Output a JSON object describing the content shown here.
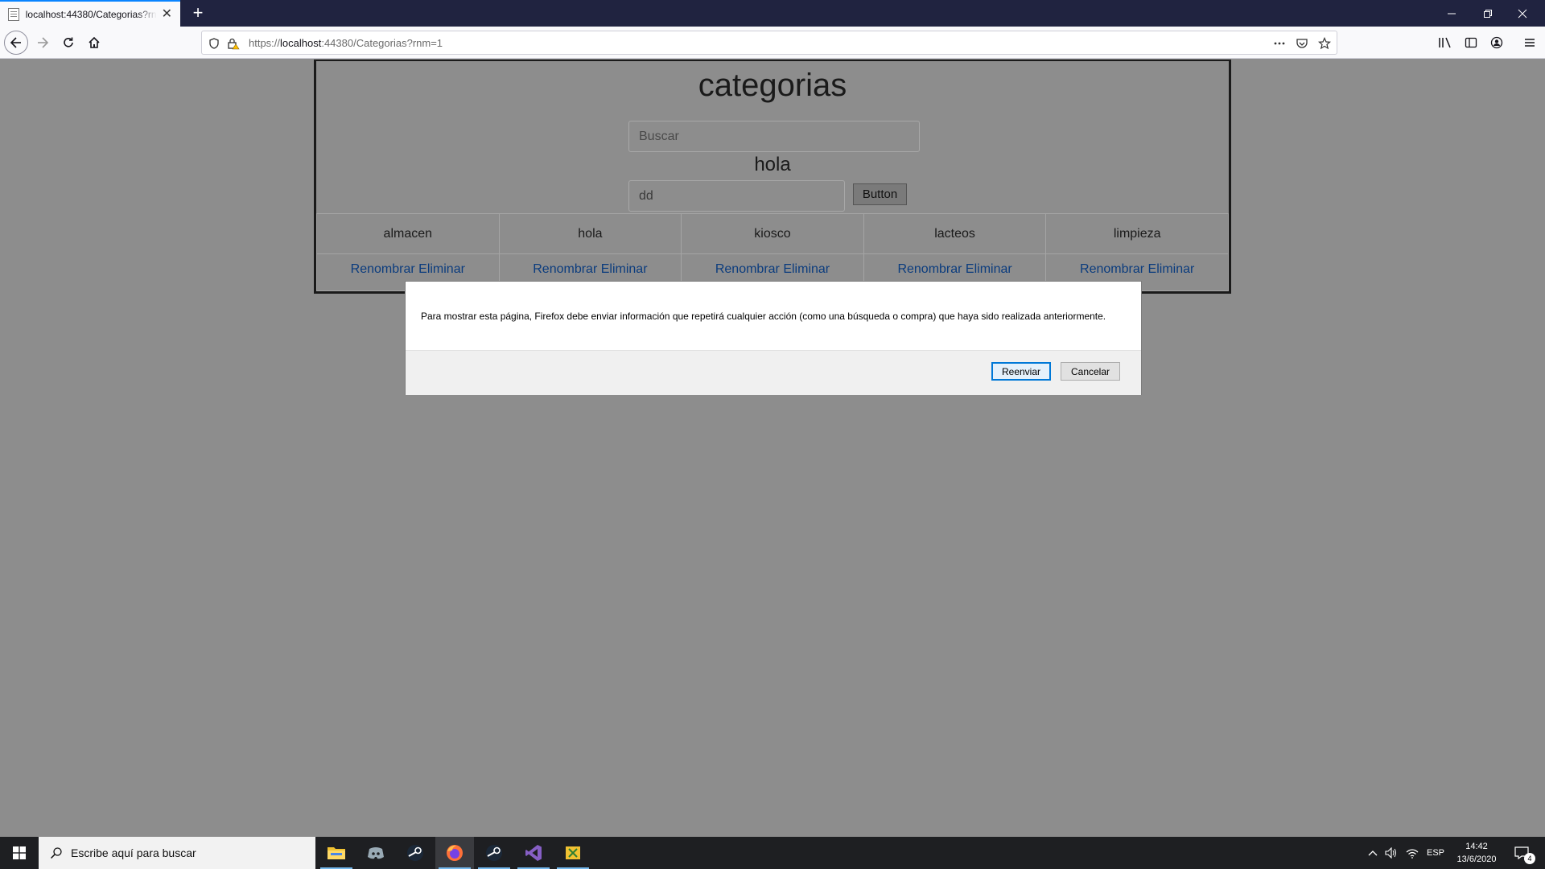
{
  "browser": {
    "tab_title": "localhost:44380/Categorias?rnm",
    "url_scheme": "https://",
    "url_host": "localhost",
    "url_rest": ":44380/Categorias?rnm=1"
  },
  "page": {
    "title": "categorias",
    "search_placeholder": "Buscar",
    "label": "hola",
    "text_value": "dd",
    "button_label": "Button",
    "categories": [
      {
        "name": "almacen",
        "rename": "Renombrar",
        "delete": "Eliminar"
      },
      {
        "name": "hola",
        "rename": "Renombrar",
        "delete": "Eliminar"
      },
      {
        "name": "kiosco",
        "rename": "Renombrar",
        "delete": "Eliminar"
      },
      {
        "name": "lacteos",
        "rename": "Renombrar",
        "delete": "Eliminar"
      },
      {
        "name": "limpieza",
        "rename": "Renombrar",
        "delete": "Eliminar"
      }
    ]
  },
  "dialog": {
    "message": "Para mostrar esta página, Firefox debe enviar información que repetirá cualquier acción (como una búsqueda o compra) que haya sido realizada anteriormente.",
    "resend_label": "Reenviar",
    "cancel_label": "Cancelar"
  },
  "taskbar": {
    "search_placeholder": "Escribe aquí para buscar",
    "language": "ESP",
    "time": "14:42",
    "date": "13/6/2020",
    "notification_count": "4"
  },
  "colors": {
    "accent": "#0078d7",
    "link": "#0b3c7e",
    "titlebar": "#202340",
    "overlay_page": "#8d8d8d"
  }
}
